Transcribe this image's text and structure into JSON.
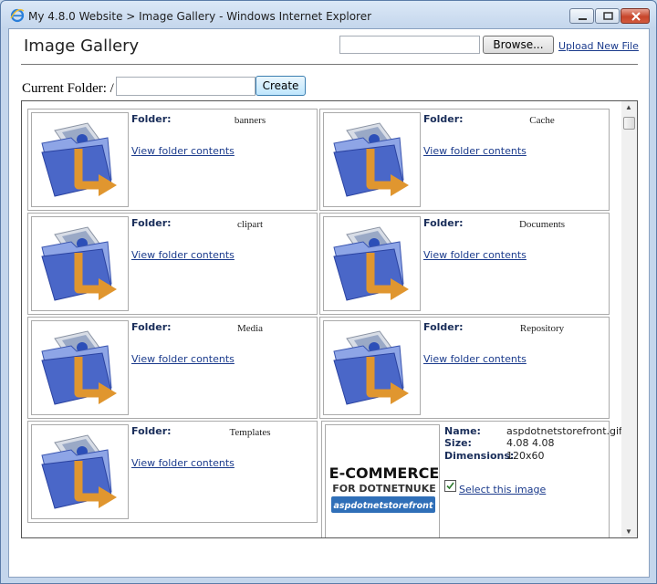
{
  "window": {
    "title": "My 4.8.0 Website > Image Gallery - Windows Internet Explorer"
  },
  "header": {
    "title": "Image Gallery",
    "upload_input_value": "",
    "browse_label": "Browse...",
    "upload_link": "Upload New File"
  },
  "folder_bar": {
    "label": "Current Folder: /",
    "input_value": "",
    "create_label": "Create"
  },
  "folders": [
    {
      "key": "Folder:",
      "name": "banners",
      "link": "View folder contents"
    },
    {
      "key": "Folder:",
      "name": "Cache",
      "link": "View folder contents"
    },
    {
      "key": "Folder:",
      "name": "clipart",
      "link": "View folder contents"
    },
    {
      "key": "Folder:",
      "name": "Documents",
      "link": "View folder contents"
    },
    {
      "key": "Folder:",
      "name": "Media",
      "link": "View folder contents"
    },
    {
      "key": "Folder:",
      "name": "Repository",
      "link": "View folder contents"
    },
    {
      "key": "Folder:",
      "name": "Templates",
      "link": "View folder contents"
    }
  ],
  "file": {
    "name_key": "Name:",
    "name": "aspdotnetstorefront.gif",
    "size_key": "Size:",
    "size": "4.08 4.08",
    "dims_key": "Dimensions:",
    "dims": "120x60",
    "select_link": "Select this image",
    "logo_line1": "E-COMMERCE",
    "logo_line2": "FOR DOTNETNUKE",
    "logo_line3": "aspdotnetstorefront"
  },
  "colors": {
    "link": "#1b3b8c",
    "label": "#1a2e5a",
    "folder_blue": "#4a67c8",
    "arrow_orange": "#e0962f"
  }
}
